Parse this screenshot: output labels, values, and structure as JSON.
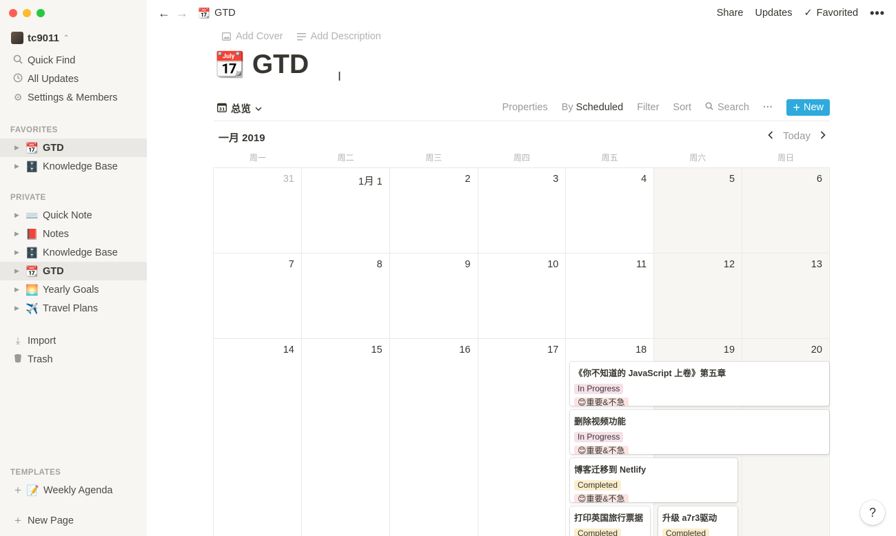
{
  "window": {
    "colors": {
      "close": "#ff5f57",
      "minimize": "#febc2e",
      "maximize": "#28c840"
    }
  },
  "sidebar": {
    "workspace": "tc9011",
    "top_items": [
      {
        "label": "Quick Find",
        "icon": "search-icon"
      },
      {
        "label": "All Updates",
        "icon": "clock-icon"
      },
      {
        "label": "Settings & Members",
        "icon": "gear-icon"
      }
    ],
    "favorites_label": "FAVORITES",
    "favorites": [
      {
        "label": "GTD",
        "emoji": "📆",
        "active": true
      },
      {
        "label": "Knowledge Base",
        "emoji": "🗄️",
        "active": false
      }
    ],
    "private_label": "PRIVATE",
    "private": [
      {
        "label": "Quick Note",
        "emoji": "⌨️"
      },
      {
        "label": "Notes",
        "emoji": "📕"
      },
      {
        "label": "Knowledge Base",
        "emoji": "🗄️"
      },
      {
        "label": "GTD",
        "emoji": "📆"
      },
      {
        "label": "Yearly Goals",
        "emoji": "🌅"
      },
      {
        "label": "Travel Plans",
        "emoji": "✈️"
      }
    ],
    "import_label": "Import",
    "trash_label": "Trash",
    "templates_label": "TEMPLATES",
    "template_item": {
      "label": "Weekly Agenda",
      "emoji": "📝"
    },
    "new_page_label": "New Page"
  },
  "topbar": {
    "breadcrumb_emoji": "📆",
    "breadcrumb": "GTD",
    "share": "Share",
    "updates": "Updates",
    "favorited": "Favorited",
    "more": "•••"
  },
  "page": {
    "add_cover": "Add Cover",
    "add_description": "Add Description",
    "emoji": "📆",
    "title": "GTD"
  },
  "view": {
    "name": "总览",
    "properties": "Properties",
    "by": "By",
    "scheduled": "Scheduled",
    "filter": "Filter",
    "sort": "Sort",
    "search": "Search",
    "more": "···",
    "new": "New"
  },
  "calendar": {
    "month": "一月 2019",
    "today": "Today",
    "weekdays": [
      "周一",
      "周二",
      "周三",
      "周四",
      "周五",
      "周六",
      "周日"
    ],
    "weeks": [
      [
        "31",
        "1月 1",
        "2",
        "3",
        "4",
        "5",
        "6"
      ],
      [
        "7",
        "8",
        "9",
        "10",
        "11",
        "12",
        "13"
      ],
      [
        "14",
        "15",
        "16",
        "17",
        "18",
        "19",
        "20"
      ]
    ]
  },
  "events": [
    {
      "title": "《你不知道的 JavaScript 上卷》第五章",
      "status": "In Progress",
      "priority": "😊重要&不急"
    },
    {
      "title": "删除视频功能",
      "status": "In Progress",
      "priority": "😊重要&不急"
    },
    {
      "title": "博客迁移到 Netlify",
      "status": "Completed",
      "priority": "😊重要&不急"
    },
    {
      "title": "打印英国旅行票据",
      "status": "Completed"
    },
    {
      "title": "升级 a7r3驱动",
      "status": "Completed"
    }
  ],
  "help": "?"
}
